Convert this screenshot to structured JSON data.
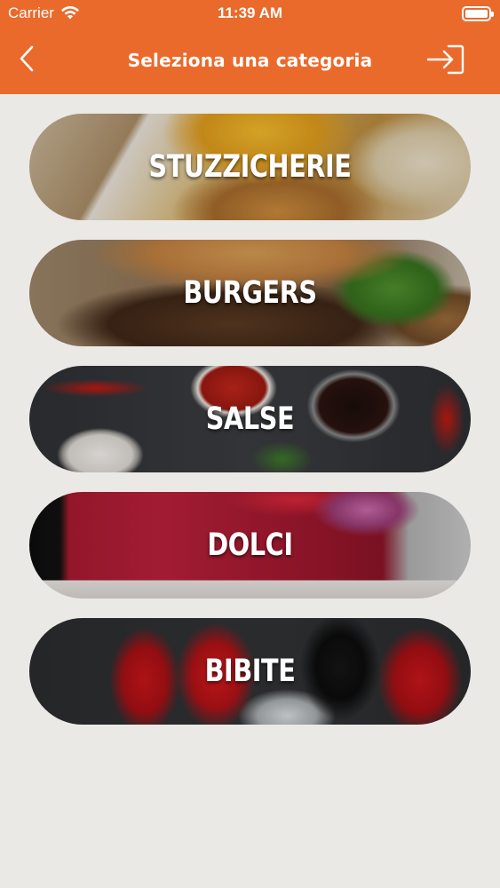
{
  "status_bar": {
    "carrier": "Carrier",
    "time": "11:39 AM"
  },
  "nav": {
    "title": "Seleziona una categoria",
    "back_icon": "chevron-left-icon",
    "logout_icon": "sign-out-icon",
    "background_color": "#ea6a2c"
  },
  "categories": [
    {
      "label": "STUZZICHERIE"
    },
    {
      "label": "BURGERS"
    },
    {
      "label": "SALSE"
    },
    {
      "label": "DOLCI"
    },
    {
      "label": "BIBITE"
    }
  ]
}
